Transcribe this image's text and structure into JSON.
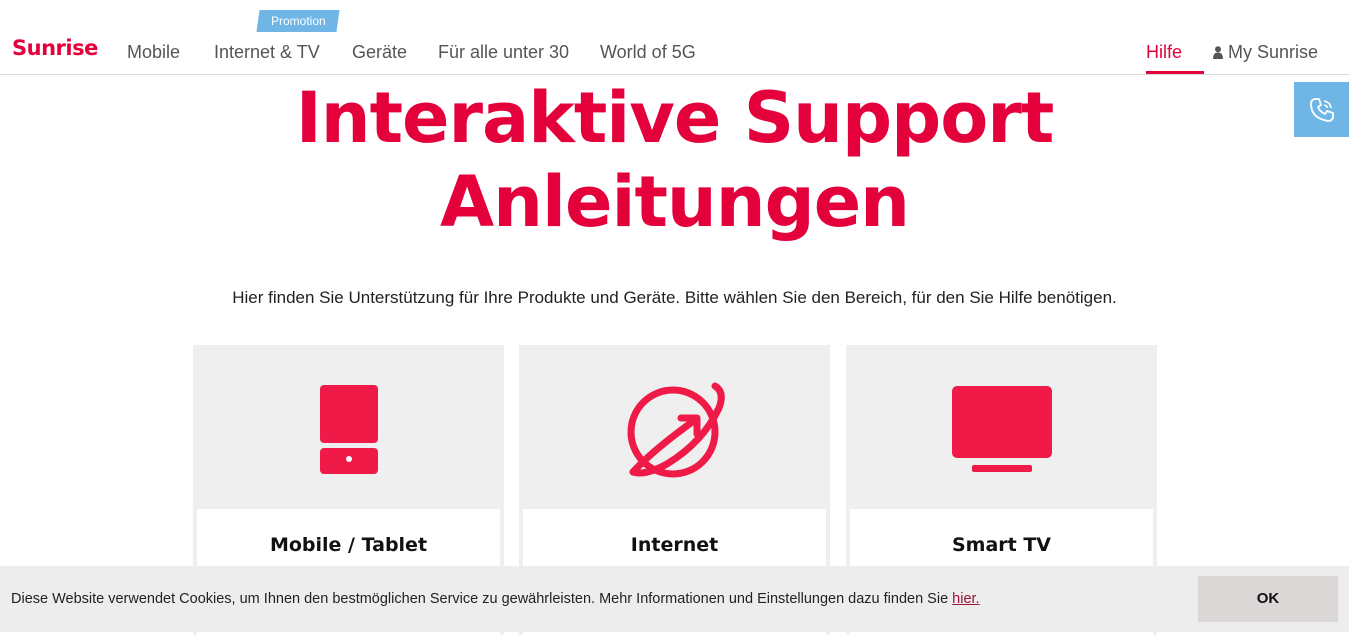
{
  "header": {
    "logo": "Sunrise",
    "nav": [
      "Mobile",
      "Internet & TV",
      "Geräte",
      "Für alle unter 30",
      "World of 5G"
    ],
    "promo_badge": "Promotion",
    "help": "Hilfe",
    "account": "My Sunrise"
  },
  "hero": {
    "title_line1": "Interaktive Support",
    "title_line2": "Anleitungen",
    "subtitle": "Hier finden Sie Unterstützung für Ihre Produkte und Geräte. Bitte wählen Sie den Bereich, für den Sie Hilfe benötigen."
  },
  "cards": [
    {
      "label": "Mobile / Tablet",
      "icon": "mobile-tablet-icon"
    },
    {
      "label": "Internet",
      "icon": "globe-icon"
    },
    {
      "label": "Smart TV",
      "icon": "tv-icon"
    }
  ],
  "cookie": {
    "text": "Diese Website verwendet Cookies, um Ihnen den bestmöglichen Service zu gewährleisten. Mehr Informationen und Einstellungen dazu finden Sie ",
    "link": "hier.",
    "ok": "OK"
  },
  "colors": {
    "brand": "#e4003b",
    "accent": "#6fb6e6"
  }
}
